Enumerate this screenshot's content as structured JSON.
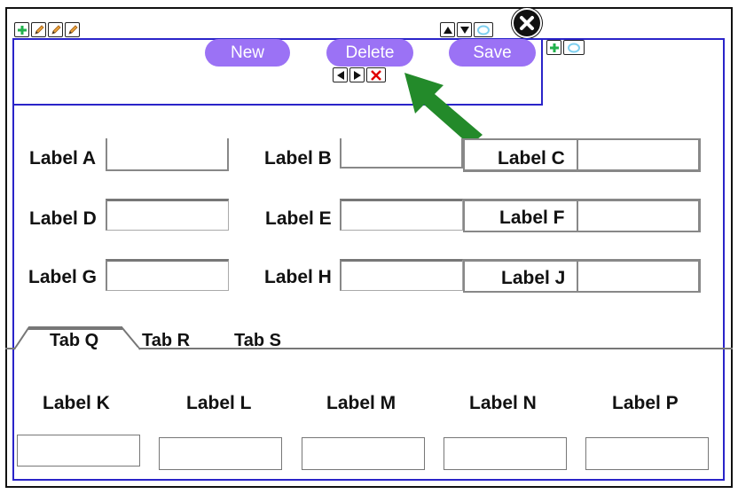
{
  "icons": {
    "left_tools": [
      "plus-icon",
      "pencil-icon",
      "pencil-icon",
      "pencil-icon"
    ],
    "top_tools": [
      "triangle-up-icon",
      "triangle-down-icon",
      "circle-icon"
    ],
    "right_tools": [
      "plus-icon",
      "circle-icon"
    ],
    "nav": [
      "triangle-left-icon",
      "triangle-right-icon",
      "x-icon"
    ]
  },
  "toolbar": {
    "new_label": "New",
    "delete_label": "Delete",
    "save_label": "Save"
  },
  "form": {
    "labels": [
      "Label A",
      "Label B",
      "Label C",
      "Label D",
      "Label E",
      "Label F",
      "Label G",
      "Label H",
      "Label J"
    ]
  },
  "tabs": [
    "Tab Q",
    "Tab R",
    "Tab S"
  ],
  "active_tab": "Tab Q",
  "tab_content": {
    "labels": [
      "Label K",
      "Label L",
      "Label M",
      "Label N",
      "Label P"
    ]
  },
  "colors": {
    "accent": "#9b72f5",
    "panel_border": "#2a24c9",
    "arrow": "#238a2a",
    "plus": "#22b14c",
    "pencil": "#e8a23c",
    "x": "#e00000"
  }
}
